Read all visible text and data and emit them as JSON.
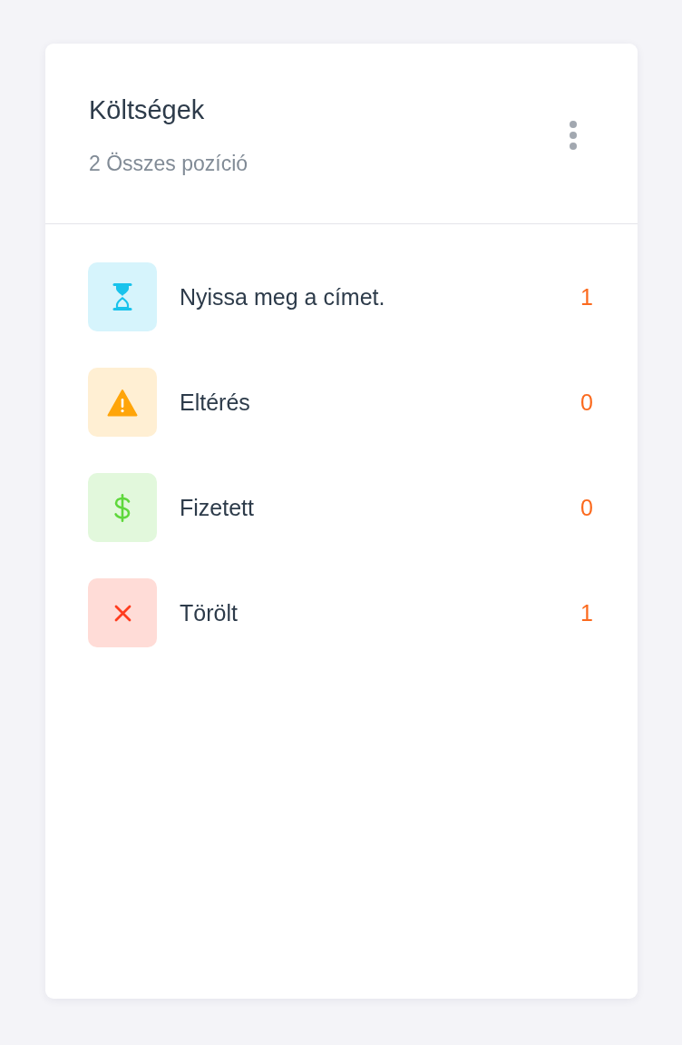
{
  "card": {
    "title": "Költségek",
    "subtitle": "2 Összes pozíció"
  },
  "items": [
    {
      "kind": "pending",
      "label": "Nyissa meg a címet.",
      "count": "1"
    },
    {
      "kind": "warning",
      "label": "Eltérés",
      "count": "0"
    },
    {
      "kind": "paid",
      "label": "Fizetett",
      "count": "0"
    },
    {
      "kind": "cancelled",
      "label": "Törölt",
      "count": "1"
    }
  ]
}
